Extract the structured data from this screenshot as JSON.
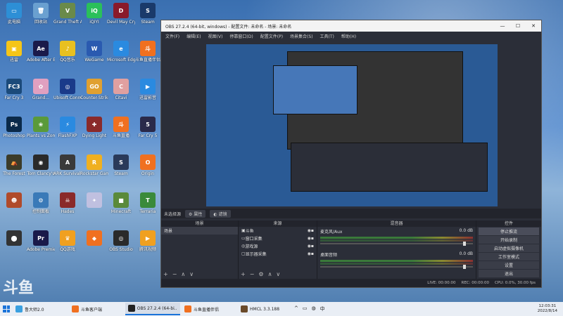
{
  "desktop_icons": [
    {
      "label": "此电脑",
      "color": "#2d8fd6",
      "glyph": "▭"
    },
    {
      "label": "迅雷",
      "color": "#f5c518",
      "glyph": "▣"
    },
    {
      "label": "Far Cry 3",
      "color": "#1b4a7a",
      "glyph": "FC3"
    },
    {
      "label": "Photoshop",
      "color": "#0b2a4a",
      "glyph": "Ps"
    },
    {
      "label": "The Forest",
      "color": "#3c3c2a",
      "glyph": "⛺"
    },
    {
      "label": "",
      "color": "#b04a2a",
      "glyph": "☻"
    },
    {
      "label": "",
      "color": "#333",
      "glyph": "⬤"
    },
    {
      "label": "回收站",
      "color": "#6aa0d0",
      "glyph": "🗑"
    },
    {
      "label": "Adobe After Effects 2020",
      "color": "#1a1a4a",
      "glyph": "Ae"
    },
    {
      "label": "Grand...",
      "color": "#e0a0c0",
      "glyph": "✿"
    },
    {
      "label": "Plants vs Zombies",
      "color": "#5a9a3a",
      "glyph": "❀"
    },
    {
      "label": "Tom Clancy's",
      "color": "#2a2a2a",
      "glyph": "◉"
    },
    {
      "label": "控制面板",
      "color": "#3a7ab8",
      "glyph": "⚙"
    },
    {
      "label": "Adobe Premiere",
      "color": "#1a1a4a",
      "glyph": "Pr"
    },
    {
      "label": "Grand Theft Auto V",
      "color": "#6a8a4a",
      "glyph": "V"
    },
    {
      "label": "QQ音乐",
      "color": "#e8c020",
      "glyph": "♪"
    },
    {
      "label": "Ubisoft Connect",
      "color": "#1a3a8a",
      "glyph": "◎"
    },
    {
      "label": "FlashFXP",
      "color": "#2a8ae0",
      "glyph": "⚡"
    },
    {
      "label": "ARK Survival Evolved",
      "color": "#3a3a3a",
      "glyph": "A"
    },
    {
      "label": "Hades",
      "color": "#8a2a2a",
      "glyph": "☠"
    },
    {
      "label": "QQ游戏",
      "color": "#f0a020",
      "glyph": "♛"
    },
    {
      "label": "iQIYI",
      "color": "#2ac05a",
      "glyph": "iQ"
    },
    {
      "label": "WeGame",
      "color": "#2a5ab0",
      "glyph": "W"
    },
    {
      "label": "Counter-Strike Global Offensive",
      "color": "#e0a030",
      "glyph": "GO"
    },
    {
      "label": "Dying Light",
      "color": "#8a2a2a",
      "glyph": "✚"
    },
    {
      "label": "Rockstar Games",
      "color": "#f0b020",
      "glyph": "R"
    },
    {
      "label": "",
      "color": "#c0c0e0",
      "glyph": "✦"
    },
    {
      "label": "",
      "color": "#f07020",
      "glyph": "◆"
    },
    {
      "label": "Devil May Cry 5",
      "color": "#8a1a2a",
      "glyph": "D"
    },
    {
      "label": "Microsoft Edge",
      "color": "#2a8ae0",
      "glyph": "e"
    },
    {
      "label": "Citavi",
      "color": "#e0a0a0",
      "glyph": "C"
    },
    {
      "label": "斗鱼直播",
      "color": "#f07020",
      "glyph": "斗"
    },
    {
      "label": "Steam",
      "color": "#2a3a5a",
      "glyph": "S"
    },
    {
      "label": "Minecraft",
      "color": "#5a8a3a",
      "glyph": "■"
    },
    {
      "label": "OBS Studio",
      "color": "#2a2a2a",
      "glyph": "◎"
    },
    {
      "label": "Steam",
      "color": "#1a3a6a",
      "glyph": "S"
    },
    {
      "label": "斗鱼直播伴侣",
      "color": "#f07020",
      "glyph": "斗"
    },
    {
      "label": "迅雷影音",
      "color": "#2a8ae0",
      "glyph": "▶"
    },
    {
      "label": "Far Cry 5",
      "color": "#2a2a4a",
      "glyph": "5"
    },
    {
      "label": "Origin",
      "color": "#f07020",
      "glyph": "O"
    },
    {
      "label": "Terraria",
      "color": "#3a8a3a",
      "glyph": "T"
    },
    {
      "label": "腾讯视频",
      "color": "#f0a020",
      "glyph": "▶"
    },
    {
      "label": "",
      "color": "#ddd",
      "glyph": "▤"
    }
  ],
  "obs": {
    "title": "OBS 27.2.4 (64-bit, windows) - 配置文件: 未命名 - 场景: 未命名",
    "menu": [
      "文件(F)",
      "编辑(E)",
      "视图(V)",
      "停靠窗口(D)",
      "配置文件(P)",
      "场景集合(S)",
      "工具(T)",
      "帮助(H)"
    ],
    "no_source": "未选择源",
    "props_btn": "属性",
    "filters_btn": "滤镜",
    "scenes_header": "场景",
    "scenes": [
      "场景"
    ],
    "sources_header": "来源",
    "sources": [
      "斗鱼",
      "窗口采集",
      "游戏源",
      "显示器采集"
    ],
    "mixer_header": "混音器",
    "mixer": [
      {
        "name": "麦克风/Aux",
        "db": "0.0 dB"
      },
      {
        "name": "桌面音频",
        "db": "0.0 dB"
      }
    ],
    "controls_header": "控件",
    "controls": [
      "停止推流",
      "开始录制",
      "启动虚拟摄像机",
      "工作室模式",
      "设置",
      "退出"
    ],
    "status": {
      "live": "LIVE: 00:00:00",
      "rec": "REC: 00:00:00",
      "cpu": "CPU: 0.0%, 30.00 fps"
    }
  },
  "taskbar": {
    "items": [
      {
        "label": "鲁大师2.0",
        "color": "#3aa0e0",
        "active": false
      },
      {
        "label": "斗鱼客户端",
        "color": "#f07020",
        "active": false
      },
      {
        "label": "OBS 27.2.4 (64-bi...",
        "color": "#222",
        "active": true
      },
      {
        "label": "斗鱼直播伴侣",
        "color": "#f07020",
        "active": false
      },
      {
        "label": "HMCL 3.3.188",
        "color": "#6a4a2a",
        "active": false
      }
    ],
    "tray": [
      "^",
      "▭",
      "◍",
      "中"
    ],
    "time": "12:03:31",
    "date": "2022/8/14"
  },
  "watermark": "斗鱼"
}
